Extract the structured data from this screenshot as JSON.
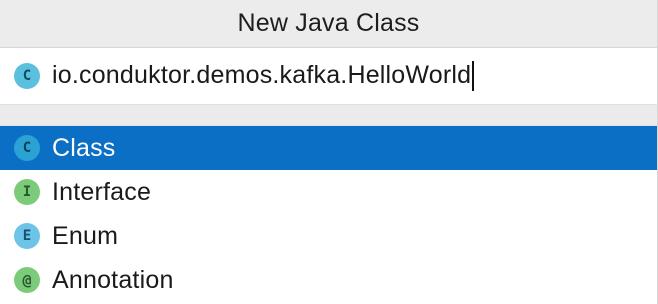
{
  "dialog": {
    "title": "New Java Class"
  },
  "name_field": {
    "icon_letter": "C",
    "value": "io.conduktor.demos.kafka.HelloWorld"
  },
  "kinds": [
    {
      "label": "Class",
      "icon": "class-icon",
      "icon_letter": "C",
      "icon_color": "#5bc0de",
      "selected": true
    },
    {
      "label": "Interface",
      "icon": "interface-icon",
      "icon_letter": "I",
      "icon_color": "#7ccb7a",
      "selected": false
    },
    {
      "label": "Enum",
      "icon": "enum-icon",
      "icon_letter": "E",
      "icon_color": "#6ec3e8",
      "selected": false
    },
    {
      "label": "Annotation",
      "icon": "annotation-icon",
      "icon_letter": "@",
      "icon_color": "#7ccb7a",
      "selected": false
    }
  ],
  "colors": {
    "selection": "#0a6fc5",
    "title_bar": "#ececec"
  }
}
